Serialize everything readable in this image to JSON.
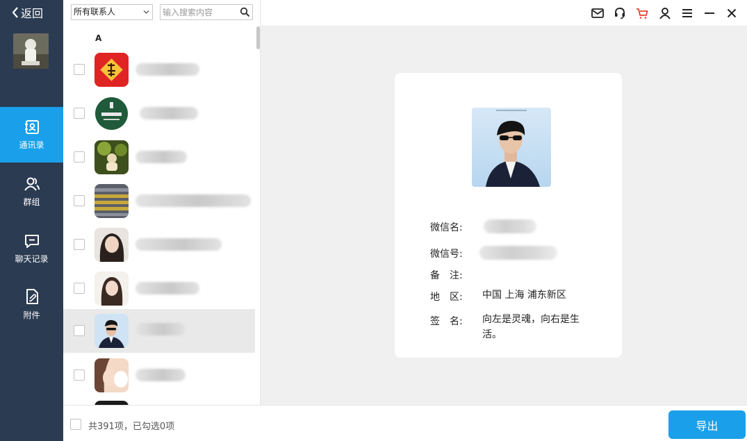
{
  "nav": {
    "back_label": "返回",
    "items": [
      {
        "label": "通讯录",
        "icon": "contacts-icon",
        "active": true
      },
      {
        "label": "群组",
        "icon": "group-icon",
        "active": false
      },
      {
        "label": "聊天记录",
        "icon": "chat-history-icon",
        "active": false
      },
      {
        "label": "附件",
        "icon": "attachment-icon",
        "active": false
      }
    ]
  },
  "list": {
    "filter_value": "所有联系人",
    "search_placeholder": "输入搜索内容",
    "section_letter": "A"
  },
  "detail": {
    "wechat_name_label": "微信名:",
    "wechat_id_label": "微信号:",
    "remark_label": "备　注:",
    "region_label": "地　区:",
    "region_value": "中国 上海 浦东新区",
    "signature_label": "签　名:",
    "signature_value": "向左是灵魂，向右是生活。"
  },
  "footer": {
    "summary": "共391项，已勾选0项",
    "export_label": "导出"
  },
  "colors": {
    "nav_bg": "#2b3b52",
    "accent": "#1aa0ea",
    "cart": "#e8412c"
  }
}
